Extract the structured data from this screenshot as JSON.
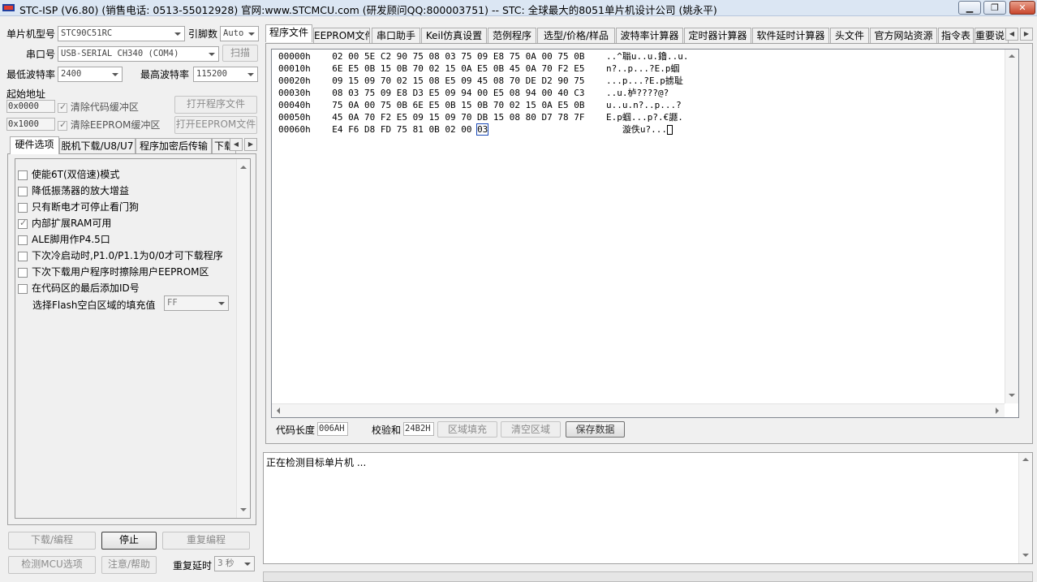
{
  "window": {
    "title": "STC-ISP (V6.80) (销售电话: 0513-55012928) 官网:www.STCMCU.com  (研发顾问QQ:800003751)  -- STC: 全球最大的8051单片机设计公司 (姚永平)",
    "minimize_glyph": "▁",
    "restore_glyph": "❐",
    "close_glyph": "✕"
  },
  "left": {
    "mcu_type_label": "单片机型号",
    "mcu_type_value": "STC90C51RC",
    "pins_label": "引脚数",
    "pins_value": "Auto",
    "port_label": "串口号",
    "port_value": "USB-SERIAL CH340 (COM4)",
    "scan_button": "扫描",
    "min_baud_label": "最低波特率",
    "min_baud_value": "2400",
    "max_baud_label": "最高波特率",
    "max_baud_value": "115200",
    "start_addr_label": "起始地址",
    "code_addr_value": "0x0000",
    "clear_code_label": "清除代码缓冲区",
    "open_program_button": "打开程序文件",
    "eeprom_addr_value": "0x1000",
    "clear_eeprom_label": "清除EEPROM缓冲区",
    "open_eeprom_button": "打开EEPROM文件",
    "tabs": [
      "硬件选项",
      "脱机下载/U8/U7",
      "程序加密后传输",
      "下载"
    ],
    "options": [
      {
        "label": "使能6T(双倍速)模式",
        "checked": false
      },
      {
        "label": "降低振荡器的放大增益",
        "checked": false
      },
      {
        "label": "只有断电才可停止看门狗",
        "checked": false
      },
      {
        "label": "内部扩展RAM可用",
        "checked": true
      },
      {
        "label": "ALE脚用作P4.5口",
        "checked": false
      },
      {
        "label": "下次冷启动时,P1.0/P1.1为0/0才可下载程序",
        "checked": false
      },
      {
        "label": "下次下载用户程序时擦除用户EEPROM区",
        "checked": false
      },
      {
        "label": "在代码区的最后添加ID号",
        "checked": false
      }
    ],
    "fill_label": "选择Flash空白区域的填充值",
    "fill_value": "FF",
    "download_button": "下载/编程",
    "stop_button": "停止",
    "reprogram_button": "重复编程",
    "detect_button": "检测MCU选项",
    "help_button": "注意/帮助",
    "repeat_delay_label": "重复延时",
    "repeat_delay_value": "3 秒"
  },
  "right": {
    "tabs": [
      "程序文件",
      "EEPROM文件",
      "串口助手",
      "Keil仿真设置",
      "范例程序",
      "选型/价格/样品",
      "波特率计算器",
      "定时器计算器",
      "软件延时计算器",
      "头文件",
      "官方网站资源",
      "指令表",
      "重要说明"
    ],
    "hex_rows": [
      {
        "addr": "00000h",
        "bytes": "02 00 5E C2 90 75 08 03 75 09 E8 75 0A 00 75 0B",
        "ascii": "..^聬u..u.鑥..u."
      },
      {
        "addr": "00010h",
        "bytes": "6E E5 0B 15 0B 70 02 15 0A E5 0B 45 0A 70 F2 E5",
        "ascii": "n?..p...?E.p蝈"
      },
      {
        "addr": "00020h",
        "bytes": "09 15 09 70 02 15 08 E5 09 45 08 70 DE D2 90 75",
        "ascii": "...p...?E.p掳耻"
      },
      {
        "addr": "00030h",
        "bytes": "08 03 75 09 E8 D3 E5 09 94 00 E5 08 94 00 40 C3",
        "ascii": "..u.栌????@?"
      },
      {
        "addr": "00040h",
        "bytes": "75 0A 00 75 0B 6E E5 0B 15 0B 70 02 15 0A E5 0B",
        "ascii": "u..u.n?..p...?"
      },
      {
        "addr": "00050h",
        "bytes": "45 0A 70 F2 E5 09 15 09 70 DB 15 08 80 D7 78 7F",
        "ascii": "E.p蝈...p?.€讔."
      },
      {
        "addr": "00060h",
        "bytes_main": "E4 F6 D8 FD 75 81 0B 02 00",
        "bytes_hl": "03",
        "ascii": "漩佚u?..."
      }
    ],
    "code_len_label": "代码长度",
    "code_len_value": "006AH",
    "checksum_label": "校验和",
    "checksum_value": "24B2H",
    "fill_area_button": "区域填充",
    "clear_area_button": "清空区域",
    "save_data_button": "保存数据"
  },
  "log": {
    "text": "正在检测目标单片机 ..."
  }
}
